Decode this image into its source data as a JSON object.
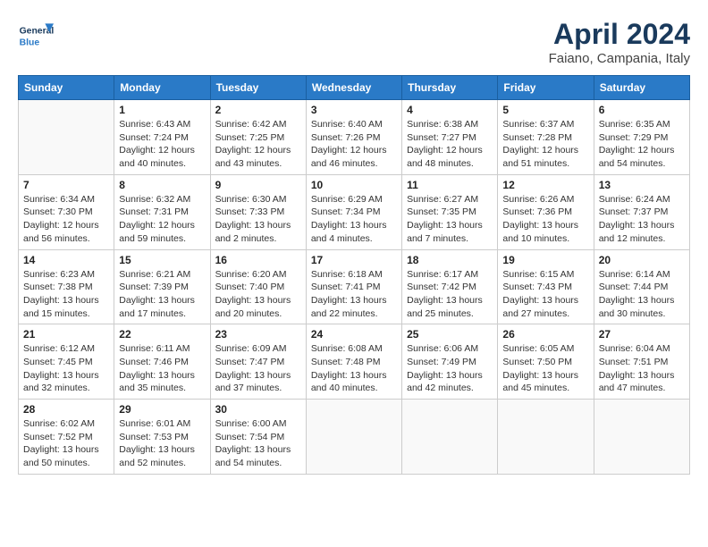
{
  "logo": {
    "general": "General",
    "blue": "Blue"
  },
  "title": {
    "month": "April 2024",
    "location": "Faiano, Campania, Italy"
  },
  "headers": [
    "Sunday",
    "Monday",
    "Tuesday",
    "Wednesday",
    "Thursday",
    "Friday",
    "Saturday"
  ],
  "weeks": [
    [
      {
        "day": "",
        "info": ""
      },
      {
        "day": "1",
        "info": "Sunrise: 6:43 AM\nSunset: 7:24 PM\nDaylight: 12 hours\nand 40 minutes."
      },
      {
        "day": "2",
        "info": "Sunrise: 6:42 AM\nSunset: 7:25 PM\nDaylight: 12 hours\nand 43 minutes."
      },
      {
        "day": "3",
        "info": "Sunrise: 6:40 AM\nSunset: 7:26 PM\nDaylight: 12 hours\nand 46 minutes."
      },
      {
        "day": "4",
        "info": "Sunrise: 6:38 AM\nSunset: 7:27 PM\nDaylight: 12 hours\nand 48 minutes."
      },
      {
        "day": "5",
        "info": "Sunrise: 6:37 AM\nSunset: 7:28 PM\nDaylight: 12 hours\nand 51 minutes."
      },
      {
        "day": "6",
        "info": "Sunrise: 6:35 AM\nSunset: 7:29 PM\nDaylight: 12 hours\nand 54 minutes."
      }
    ],
    [
      {
        "day": "7",
        "info": "Sunrise: 6:34 AM\nSunset: 7:30 PM\nDaylight: 12 hours\nand 56 minutes."
      },
      {
        "day": "8",
        "info": "Sunrise: 6:32 AM\nSunset: 7:31 PM\nDaylight: 12 hours\nand 59 minutes."
      },
      {
        "day": "9",
        "info": "Sunrise: 6:30 AM\nSunset: 7:33 PM\nDaylight: 13 hours\nand 2 minutes."
      },
      {
        "day": "10",
        "info": "Sunrise: 6:29 AM\nSunset: 7:34 PM\nDaylight: 13 hours\nand 4 minutes."
      },
      {
        "day": "11",
        "info": "Sunrise: 6:27 AM\nSunset: 7:35 PM\nDaylight: 13 hours\nand 7 minutes."
      },
      {
        "day": "12",
        "info": "Sunrise: 6:26 AM\nSunset: 7:36 PM\nDaylight: 13 hours\nand 10 minutes."
      },
      {
        "day": "13",
        "info": "Sunrise: 6:24 AM\nSunset: 7:37 PM\nDaylight: 13 hours\nand 12 minutes."
      }
    ],
    [
      {
        "day": "14",
        "info": "Sunrise: 6:23 AM\nSunset: 7:38 PM\nDaylight: 13 hours\nand 15 minutes."
      },
      {
        "day": "15",
        "info": "Sunrise: 6:21 AM\nSunset: 7:39 PM\nDaylight: 13 hours\nand 17 minutes."
      },
      {
        "day": "16",
        "info": "Sunrise: 6:20 AM\nSunset: 7:40 PM\nDaylight: 13 hours\nand 20 minutes."
      },
      {
        "day": "17",
        "info": "Sunrise: 6:18 AM\nSunset: 7:41 PM\nDaylight: 13 hours\nand 22 minutes."
      },
      {
        "day": "18",
        "info": "Sunrise: 6:17 AM\nSunset: 7:42 PM\nDaylight: 13 hours\nand 25 minutes."
      },
      {
        "day": "19",
        "info": "Sunrise: 6:15 AM\nSunset: 7:43 PM\nDaylight: 13 hours\nand 27 minutes."
      },
      {
        "day": "20",
        "info": "Sunrise: 6:14 AM\nSunset: 7:44 PM\nDaylight: 13 hours\nand 30 minutes."
      }
    ],
    [
      {
        "day": "21",
        "info": "Sunrise: 6:12 AM\nSunset: 7:45 PM\nDaylight: 13 hours\nand 32 minutes."
      },
      {
        "day": "22",
        "info": "Sunrise: 6:11 AM\nSunset: 7:46 PM\nDaylight: 13 hours\nand 35 minutes."
      },
      {
        "day": "23",
        "info": "Sunrise: 6:09 AM\nSunset: 7:47 PM\nDaylight: 13 hours\nand 37 minutes."
      },
      {
        "day": "24",
        "info": "Sunrise: 6:08 AM\nSunset: 7:48 PM\nDaylight: 13 hours\nand 40 minutes."
      },
      {
        "day": "25",
        "info": "Sunrise: 6:06 AM\nSunset: 7:49 PM\nDaylight: 13 hours\nand 42 minutes."
      },
      {
        "day": "26",
        "info": "Sunrise: 6:05 AM\nSunset: 7:50 PM\nDaylight: 13 hours\nand 45 minutes."
      },
      {
        "day": "27",
        "info": "Sunrise: 6:04 AM\nSunset: 7:51 PM\nDaylight: 13 hours\nand 47 minutes."
      }
    ],
    [
      {
        "day": "28",
        "info": "Sunrise: 6:02 AM\nSunset: 7:52 PM\nDaylight: 13 hours\nand 50 minutes."
      },
      {
        "day": "29",
        "info": "Sunrise: 6:01 AM\nSunset: 7:53 PM\nDaylight: 13 hours\nand 52 minutes."
      },
      {
        "day": "30",
        "info": "Sunrise: 6:00 AM\nSunset: 7:54 PM\nDaylight: 13 hours\nand 54 minutes."
      },
      {
        "day": "",
        "info": ""
      },
      {
        "day": "",
        "info": ""
      },
      {
        "day": "",
        "info": ""
      },
      {
        "day": "",
        "info": ""
      }
    ]
  ]
}
